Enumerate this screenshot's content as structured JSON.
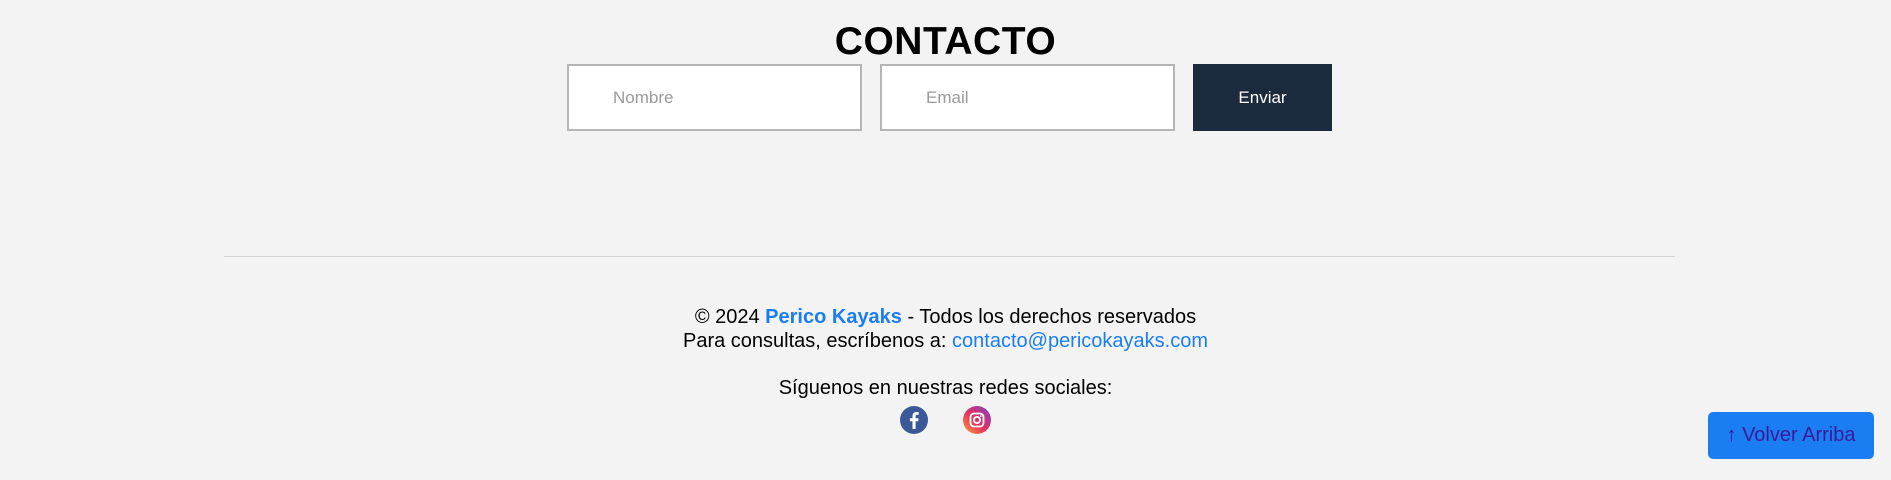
{
  "contact": {
    "title": "CONTACTO",
    "name_placeholder": "Nombre",
    "email_placeholder": "Email",
    "send_label": "Enviar"
  },
  "footer": {
    "copyright_prefix": "© 2024 ",
    "brand": "Perico Kayaks",
    "copyright_suffix": " - Todos los derechos reservados",
    "consult_text": "Para consultas, escríbenos a: ",
    "email": "contacto@pericokayaks.com",
    "social_title": "Síguenos en nuestras redes sociales:",
    "social_icons": [
      "facebook-icon",
      "instagram-icon"
    ]
  },
  "back_to_top": {
    "label": "↑ Volver Arriba"
  },
  "colors": {
    "background": "#f3f3f3",
    "button_dark": "#1c2a3e",
    "accent": "#1a7ef2",
    "divider": "#d6d6d6"
  }
}
